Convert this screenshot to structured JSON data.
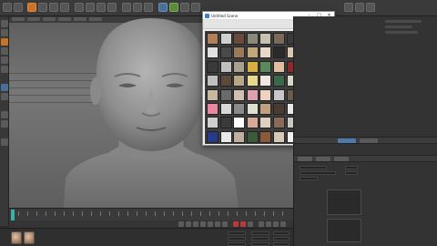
{
  "texture_window": {
    "title": "Untitled Scene",
    "minimize_glyph": "–",
    "maximize_glyph": "□",
    "close_glyph": "✕",
    "tile_colors": [
      [
        "#b08058",
        "#d0d0d0",
        "#6a4a3a",
        "#8a8a7a",
        "#c8c0b0",
        "#7a6a5a",
        "#3a3a3a",
        "#5a4a40",
        "#c8b8a8"
      ],
      [
        "#e0e0e0",
        "#4a4a4a",
        "#9a7a5a",
        "#c0a878",
        "#e8d8c8",
        "#2a2a2a",
        "#d8c8b0",
        "#7a5a40",
        "#b0a090"
      ],
      [
        "#3a3a3a",
        "#c0c0c0",
        "#a8a090",
        "#d8b040",
        "#5a8a5a",
        "#e0c0a0",
        "#8a2a2a",
        "#4a4a4a",
        "#d0d0d0"
      ],
      [
        "#c0c0c0",
        "#5a4a3a",
        "#b8a888",
        "#e8d890",
        "#f0e8e0",
        "#3a6a4a",
        "#d8d8c8",
        "#9a9a8a",
        "#a04040"
      ],
      [
        "#c8b8a0",
        "#6a6a6a",
        "#d0c0b0",
        "#e0a0b0",
        "#f0d0c0",
        "#c8c8c8",
        "#6a5a4a",
        "#b0b0a0",
        "#e8e8e8"
      ],
      [
        "#e888a0",
        "#d8d8d8",
        "#8a8a8a",
        "#e0e0d0",
        "#c0a080",
        "#4a3a30",
        "#e8e8e8",
        "#7a7a7a",
        "#3a3a3a"
      ],
      [
        "#d0d0d0",
        "#3a3a3a",
        "#ffffff",
        "#d8a898",
        "#e0d0c0",
        "#8a6a5a",
        "#c8c8c0",
        "#f0f0f0",
        "#5a5a5a"
      ],
      [
        "#2a3a8a",
        "#e8e8e8",
        "#c0b0a0",
        "#3a5a3a",
        "#8a5a3a",
        "#d8c8b8",
        "#f0f0f0",
        "#6a6a6a",
        "#e8e8e0"
      ]
    ]
  },
  "timeline": {
    "tick_count": 30
  },
  "colors": {
    "accent": "#c8732a",
    "selection": "#4f79a8",
    "timeline_marker": "#3cb0a4",
    "record": "#b83a3a"
  }
}
